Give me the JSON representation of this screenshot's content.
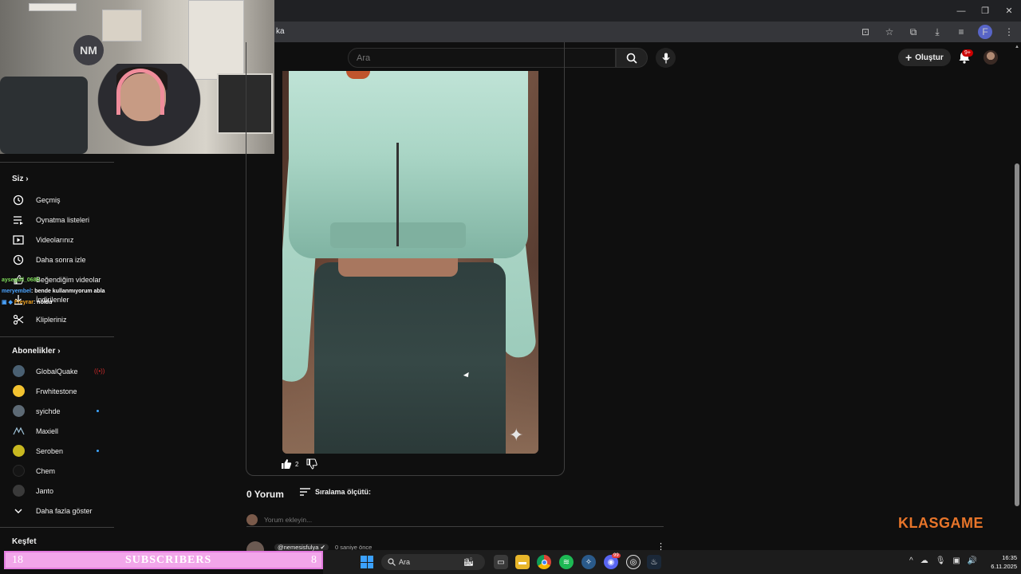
{
  "browser": {
    "url_fragment": "ka",
    "window_controls": [
      "minimize",
      "restore",
      "close"
    ]
  },
  "header": {
    "search_placeholder": "Ara",
    "create_label": "Oluştur",
    "notification_badge": "9+"
  },
  "webcam": {
    "overlay_logo": "NM"
  },
  "sidebar": {
    "you_section": "Siz",
    "you_items": [
      {
        "label": "Geçmiş",
        "icon": "history-icon"
      },
      {
        "label": "Oynatma listeleri",
        "icon": "playlist-icon"
      },
      {
        "label": "Videolarınız",
        "icon": "your-videos-icon"
      },
      {
        "label": "Daha sonra izle",
        "icon": "watch-later-icon"
      },
      {
        "label": "Beğendiğim videolar",
        "icon": "liked-icon"
      },
      {
        "label": "İndirilenler",
        "icon": "download-icon"
      },
      {
        "label": "Klipleriniz",
        "icon": "clips-icon"
      }
    ],
    "subs_section": "Abonelikler",
    "subscriptions": [
      {
        "label": "GlobalQuake",
        "color": "#4a6072",
        "badge": "live"
      },
      {
        "label": "Frwhitestone",
        "color": "#f2c230",
        "badge": ""
      },
      {
        "label": "syichde",
        "color": "#5d6a75",
        "badge": "dot"
      },
      {
        "label": "Maxiell",
        "color": "#0f0f0f",
        "badge": ""
      },
      {
        "label": "Seroben",
        "color": "#c8b820",
        "badge": "dot"
      },
      {
        "label": "Chem",
        "color": "#151515",
        "badge": ""
      },
      {
        "label": "Janto",
        "color": "#3a3a3a",
        "badge": ""
      }
    ],
    "show_more": "Daha fazla göster",
    "explore_section": "Keşfet"
  },
  "chat": [
    {
      "user": "aysegull_0685",
      "message": "",
      "color": "#7fdc5a"
    },
    {
      "user": "meryembel",
      "message": ": bende kullanmıyorum abla",
      "color": "#4aa3ff"
    },
    {
      "user": "Freyrar",
      "message": ": noldu",
      "color": "#f5a623"
    }
  ],
  "post": {
    "like_count": "2"
  },
  "comments": {
    "count_label": "0 Yorum",
    "sort_label": "Sıralama ölçütü:",
    "add_placeholder": "Yorum ekleyin...",
    "first": {
      "author": "@nemesisfulya",
      "time": "0 saniye önce"
    }
  },
  "watermark": "KLASGAME",
  "subscribers_bar": {
    "left": "18",
    "title": "SUBSCRIBERS",
    "right": "8"
  },
  "taskbar": {
    "search_label": "Ara",
    "time": "16:35",
    "date": "6.11.2025",
    "discord_badge": "99"
  },
  "colors": {
    "background": "#0f0f0f",
    "accent_orange": "#e8752a",
    "subs_pink": "#f2a6ea"
  }
}
